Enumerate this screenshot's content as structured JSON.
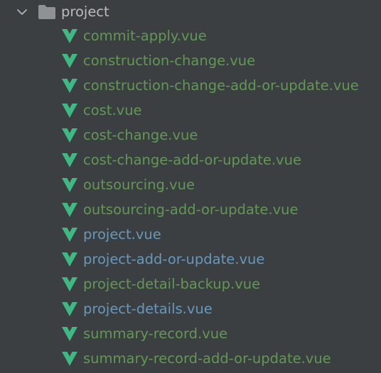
{
  "colors": {
    "background": "#3c3f41",
    "folder_text": "#bbbbbb",
    "added_text": "#629755",
    "modified_text": "#6897bb",
    "vue_icon": "#41b883",
    "folder_icon": "#8e9297"
  },
  "tree": {
    "toggle_icon": "chevron-down-icon",
    "folder_icon": "folder-icon",
    "folder_name": "project",
    "file_icon": "vue-icon",
    "files": [
      {
        "name": "commit-apply.vue",
        "status": "added"
      },
      {
        "name": "construction-change.vue",
        "status": "added"
      },
      {
        "name": "construction-change-add-or-update.vue",
        "status": "added"
      },
      {
        "name": "cost.vue",
        "status": "added"
      },
      {
        "name": "cost-change.vue",
        "status": "added"
      },
      {
        "name": "cost-change-add-or-update.vue",
        "status": "added"
      },
      {
        "name": "outsourcing.vue",
        "status": "added"
      },
      {
        "name": "outsourcing-add-or-update.vue",
        "status": "added"
      },
      {
        "name": "project.vue",
        "status": "modified"
      },
      {
        "name": "project-add-or-update.vue",
        "status": "modified"
      },
      {
        "name": "project-detail-backup.vue",
        "status": "added"
      },
      {
        "name": "project-details.vue",
        "status": "modified"
      },
      {
        "name": "summary-record.vue",
        "status": "added"
      },
      {
        "name": "summary-record-add-or-update.vue",
        "status": "added"
      }
    ]
  }
}
